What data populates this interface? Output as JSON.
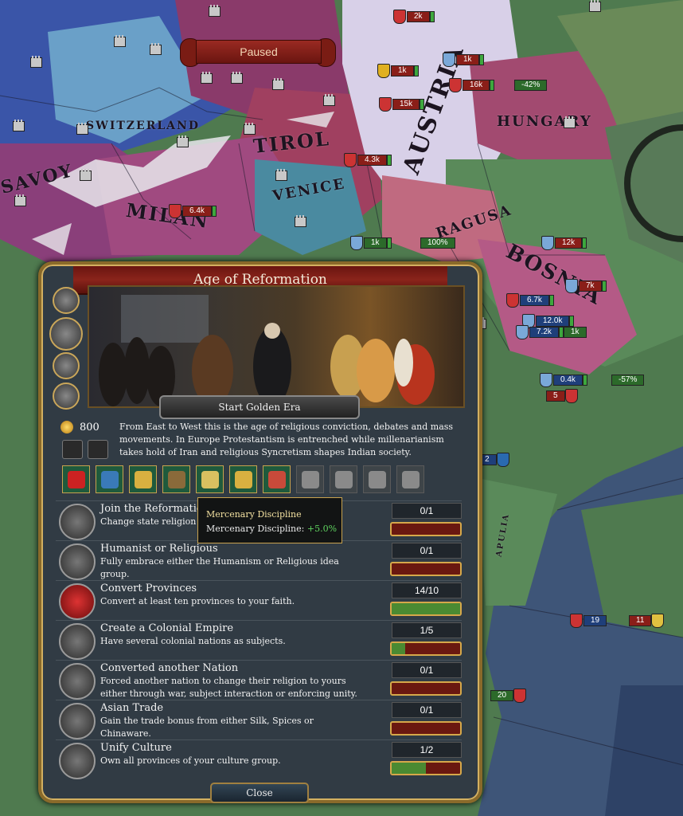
{
  "map": {
    "labels": [
      "SAVOY",
      "SWITZERLAND",
      "TIROL",
      "MILAN",
      "VENICE",
      "AUSTRIA",
      "HUNGARY",
      "RAGUSA",
      "BOSNIA",
      "APULIA"
    ],
    "armies": [
      {
        "value": "2k",
        "color": "red"
      },
      {
        "value": "1k",
        "color": "red"
      },
      {
        "value": "1k",
        "color": "red"
      },
      {
        "value": "16k",
        "color": "red"
      },
      {
        "value": "-42%",
        "color": "green"
      },
      {
        "value": "15k",
        "color": "red"
      },
      {
        "value": "4.3k",
        "color": "red"
      },
      {
        "value": "6.4k",
        "color": "red"
      },
      {
        "value": "1k",
        "color": "green"
      },
      {
        "value": "100%",
        "color": "green"
      },
      {
        "value": "12k",
        "color": "red"
      },
      {
        "value": "7k",
        "color": "red"
      },
      {
        "value": "6.7k",
        "color": "blue"
      },
      {
        "value": "12.0k",
        "color": "blue"
      },
      {
        "value": "7.2k",
        "color": "blue"
      },
      {
        "value": "1k",
        "color": "green"
      },
      {
        "value": "0.4k",
        "color": "blue"
      },
      {
        "value": "-57%",
        "color": "green"
      },
      {
        "value": "5",
        "color": "red"
      },
      {
        "value": "2",
        "color": "blue"
      },
      {
        "value": "19",
        "color": "blue"
      },
      {
        "value": "11",
        "color": "red"
      },
      {
        "value": "20",
        "color": "green"
      }
    ]
  },
  "paused": "Paused",
  "panel": {
    "title": "Age of Reformation",
    "golden_era_button": "Start Golden Era",
    "splendor": "800",
    "description": "From East to West this is the age of religious conviction, debates and mass movements. In Europe Protestantism is entrenched while millenarianism takes hold of Iran and religious Syncretism shapes Indian society.",
    "abilities": [
      {
        "icon": "cardinal-icon",
        "active": true
      },
      {
        "icon": "ship-icon",
        "active": true
      },
      {
        "icon": "crossed-swords-icon",
        "active": true
      },
      {
        "icon": "mercenary-icon",
        "active": true
      },
      {
        "icon": "funnel-icon",
        "active": true
      },
      {
        "icon": "scales-icon",
        "active": true
      },
      {
        "icon": "medal-icon",
        "active": true
      },
      {
        "icon": "shield-icon",
        "active": false
      },
      {
        "icon": "cannon-icon",
        "active": false
      },
      {
        "icon": "horse-icon",
        "active": false
      },
      {
        "icon": "diplomacy-icon",
        "active": false
      }
    ],
    "objectives": [
      {
        "title": "Join the Reformation",
        "desc": "Change state religion to a Reformed religion.",
        "count": "0/1",
        "progress": 0.0,
        "icon": "cross-icon"
      },
      {
        "title": "Humanist or Religious",
        "desc": "Fully embrace either the Humanism or Religious idea group.",
        "count": "0/1",
        "progress": 0.0,
        "icon": "lightbulb-icon"
      },
      {
        "title": "Convert Provinces",
        "desc": "Convert at least ten provinces to your faith.",
        "count": "14/10",
        "progress": 1.0,
        "icon": "cardinal-icon"
      },
      {
        "title": "Create a Colonial Empire",
        "desc": "Have several colonial nations as subjects.",
        "count": "1/5",
        "progress": 0.2,
        "icon": "colony-icon"
      },
      {
        "title": "Converted another Nation",
        "desc": "Forced another nation to change their religion to yours either through war, subject interaction or enforcing unity.",
        "count": "0/1",
        "progress": 0.0,
        "icon": "convert-icon"
      },
      {
        "title": "Asian Trade",
        "desc": "Gain the trade bonus from either Silk, Spices or Chinaware.",
        "count": "0/1",
        "progress": 0.0,
        "icon": "trade-icon"
      },
      {
        "title": "Unify Culture",
        "desc": "Own all provinces of your culture group.",
        "count": "1/2",
        "progress": 0.5,
        "icon": "masks-icon"
      }
    ],
    "close_button": "Close"
  },
  "tooltip": {
    "title": "Mercenary Discipline",
    "line_label": "Mercenary Discipline: ",
    "line_value": "+5.0%"
  }
}
